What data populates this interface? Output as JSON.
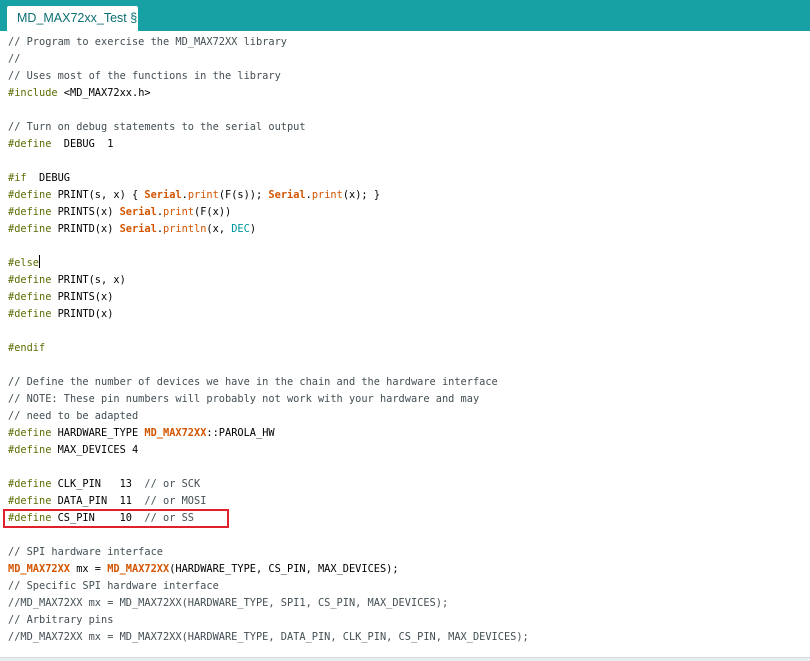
{
  "tab": {
    "label": "MD_MAX72xx_Test §"
  },
  "code": [
    [
      {
        "t": "// Program to exercise the MD_MAX72XX library",
        "c": "c"
      }
    ],
    [
      {
        "t": "//",
        "c": "c"
      }
    ],
    [
      {
        "t": "// Uses most of the functions in the library",
        "c": "c"
      }
    ],
    [
      {
        "t": "#include",
        "c": "p"
      },
      {
        "t": " <MD_MAX72xx.h>",
        "c": ""
      }
    ],
    [],
    [
      {
        "t": "// Turn on debug statements to the serial output",
        "c": "c"
      }
    ],
    [
      {
        "t": "#define",
        "c": "p"
      },
      {
        "t": "  DEBUG  1",
        "c": ""
      }
    ],
    [],
    [
      {
        "t": "#if",
        "c": "p"
      },
      {
        "t": "  DEBUG",
        "c": ""
      }
    ],
    [
      {
        "t": "#define",
        "c": "p"
      },
      {
        "t": " PRINT(s, x) { ",
        "c": ""
      },
      {
        "t": "Serial",
        "c": "kb"
      },
      {
        "t": ".",
        "c": ""
      },
      {
        "t": "print",
        "c": "k"
      },
      {
        "t": "(F(s)); ",
        "c": ""
      },
      {
        "t": "Serial",
        "c": "kb"
      },
      {
        "t": ".",
        "c": ""
      },
      {
        "t": "print",
        "c": "k"
      },
      {
        "t": "(x); }",
        "c": ""
      }
    ],
    [
      {
        "t": "#define",
        "c": "p"
      },
      {
        "t": " PRINTS(x) ",
        "c": ""
      },
      {
        "t": "Serial",
        "c": "kb"
      },
      {
        "t": ".",
        "c": ""
      },
      {
        "t": "print",
        "c": "k"
      },
      {
        "t": "(F(x))",
        "c": ""
      }
    ],
    [
      {
        "t": "#define",
        "c": "p"
      },
      {
        "t": " PRINTD(x) ",
        "c": ""
      },
      {
        "t": "Serial",
        "c": "kb"
      },
      {
        "t": ".",
        "c": ""
      },
      {
        "t": "println",
        "c": "k"
      },
      {
        "t": "(x, ",
        "c": ""
      },
      {
        "t": "DEC",
        "c": "lit"
      },
      {
        "t": ")",
        "c": ""
      }
    ],
    [],
    [
      {
        "t": "#else",
        "c": "p"
      },
      {
        "t": "",
        "c": "cursor"
      }
    ],
    [
      {
        "t": "#define",
        "c": "p"
      },
      {
        "t": " PRINT(s, x)",
        "c": ""
      }
    ],
    [
      {
        "t": "#define",
        "c": "p"
      },
      {
        "t": " PRINTS(x)",
        "c": ""
      }
    ],
    [
      {
        "t": "#define",
        "c": "p"
      },
      {
        "t": " PRINTD(x)",
        "c": ""
      }
    ],
    [],
    [
      {
        "t": "#endif",
        "c": "p"
      }
    ],
    [],
    [
      {
        "t": "// Define the number of devices we have in the chain and the hardware interface",
        "c": "c"
      }
    ],
    [
      {
        "t": "// NOTE: These pin numbers will probably not work with your hardware and may",
        "c": "c"
      }
    ],
    [
      {
        "t": "// need to be adapted",
        "c": "c"
      }
    ],
    [
      {
        "t": "#define",
        "c": "p"
      },
      {
        "t": " HARDWARE_TYPE ",
        "c": ""
      },
      {
        "t": "MD_MAX72XX",
        "c": "kb"
      },
      {
        "t": "::PAROLA_HW",
        "c": ""
      }
    ],
    [
      {
        "t": "#define",
        "c": "p"
      },
      {
        "t": " MAX_DEVICES 4",
        "c": ""
      }
    ],
    [],
    [
      {
        "t": "#define",
        "c": "p"
      },
      {
        "t": " CLK_PIN   13  ",
        "c": ""
      },
      {
        "t": "// or SCK",
        "c": "c"
      }
    ],
    [
      {
        "t": "#define",
        "c": "p"
      },
      {
        "t": " DATA_PIN  11  ",
        "c": ""
      },
      {
        "t": "// or MOSI",
        "c": "c"
      }
    ],
    [
      {
        "t": "#define",
        "c": "p"
      },
      {
        "t": " CS_PIN    10  ",
        "c": ""
      },
      {
        "t": "// or SS",
        "c": "c"
      }
    ],
    [],
    [
      {
        "t": "// SPI hardware interface",
        "c": "c"
      }
    ],
    [
      {
        "t": "MD_MAX72XX",
        "c": "kb"
      },
      {
        "t": " mx = ",
        "c": ""
      },
      {
        "t": "MD_MAX72XX",
        "c": "kb"
      },
      {
        "t": "(HARDWARE_TYPE, CS_PIN, MAX_DEVICES);",
        "c": ""
      }
    ],
    [
      {
        "t": "// Specific SPI hardware interface",
        "c": "c"
      }
    ],
    [
      {
        "t": "//MD_MAX72XX mx = MD_MAX72XX(HARDWARE_TYPE, SPI1, CS_PIN, MAX_DEVICES);",
        "c": "c"
      }
    ],
    [
      {
        "t": "// Arbitrary pins",
        "c": "c"
      }
    ],
    [
      {
        "t": "//MD_MAX72XX mx = MD_MAX72XX(HARDWARE_TYPE, DATA_PIN, CLK_PIN, CS_PIN, MAX_DEVICES);",
        "c": "c"
      }
    ]
  ]
}
